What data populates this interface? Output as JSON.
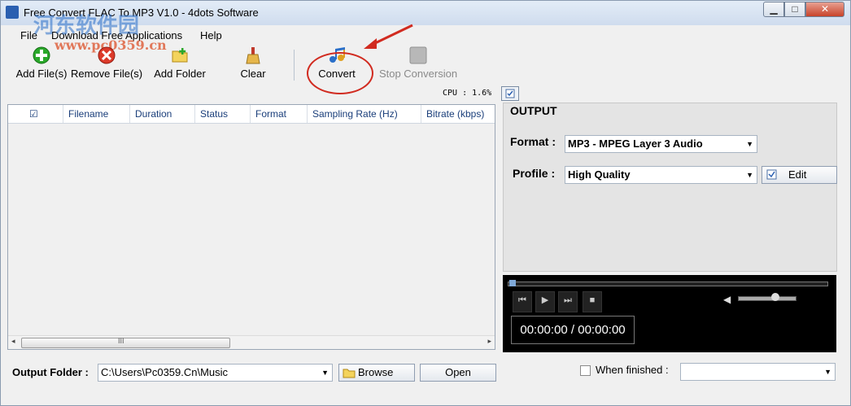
{
  "window": {
    "title": "Free Convert FLAC To MP3 V1.0 - 4dots Software",
    "min_glyph": "▁",
    "max_glyph": "□",
    "close_glyph": "✕"
  },
  "watermark": {
    "line1": "河东软件园",
    "line2": "www.pc0359.cn"
  },
  "menu": {
    "file": "File",
    "download": "Download Free Applications",
    "help": "Help"
  },
  "toolbar": {
    "add_files": "Add File(s)",
    "remove_files": "Remove File(s)",
    "add_folder": "Add Folder",
    "clear": "Clear",
    "convert": "Convert",
    "stop": "Stop Conversion"
  },
  "cpu": "CPU : 1.6%",
  "table": {
    "check": "☑",
    "headers": [
      "Filename",
      "Duration",
      "Status",
      "Format",
      "Sampling Rate (Hz)",
      "Bitrate (kbps)"
    ]
  },
  "scroll": {
    "left": "◂",
    "right": "▸",
    "grip": "III"
  },
  "output": {
    "title": "OUTPUT",
    "format_label": "Format :",
    "format_value": "MP3 - MPEG Layer 3 Audio",
    "profile_label": "Profile :",
    "profile_value": "High Quality",
    "edit": "Edit"
  },
  "player": {
    "time": "00:00:00 / 00:00:00",
    "prev": "⏮",
    "play": "▶",
    "next": "⏭",
    "stop": "■",
    "volume_icon": "◀",
    "seek_fraction": 0.0,
    "volume_fraction": 0.65
  },
  "bottom": {
    "output_folder_label": "Output Folder :",
    "output_folder_value": "C:\\Users\\Pc0359.Cn\\Music",
    "browse": "Browse",
    "open": "Open",
    "when_finished": "When finished :"
  },
  "colors": {
    "annotation": "#d12b20",
    "accent": "#2a5fb0"
  }
}
